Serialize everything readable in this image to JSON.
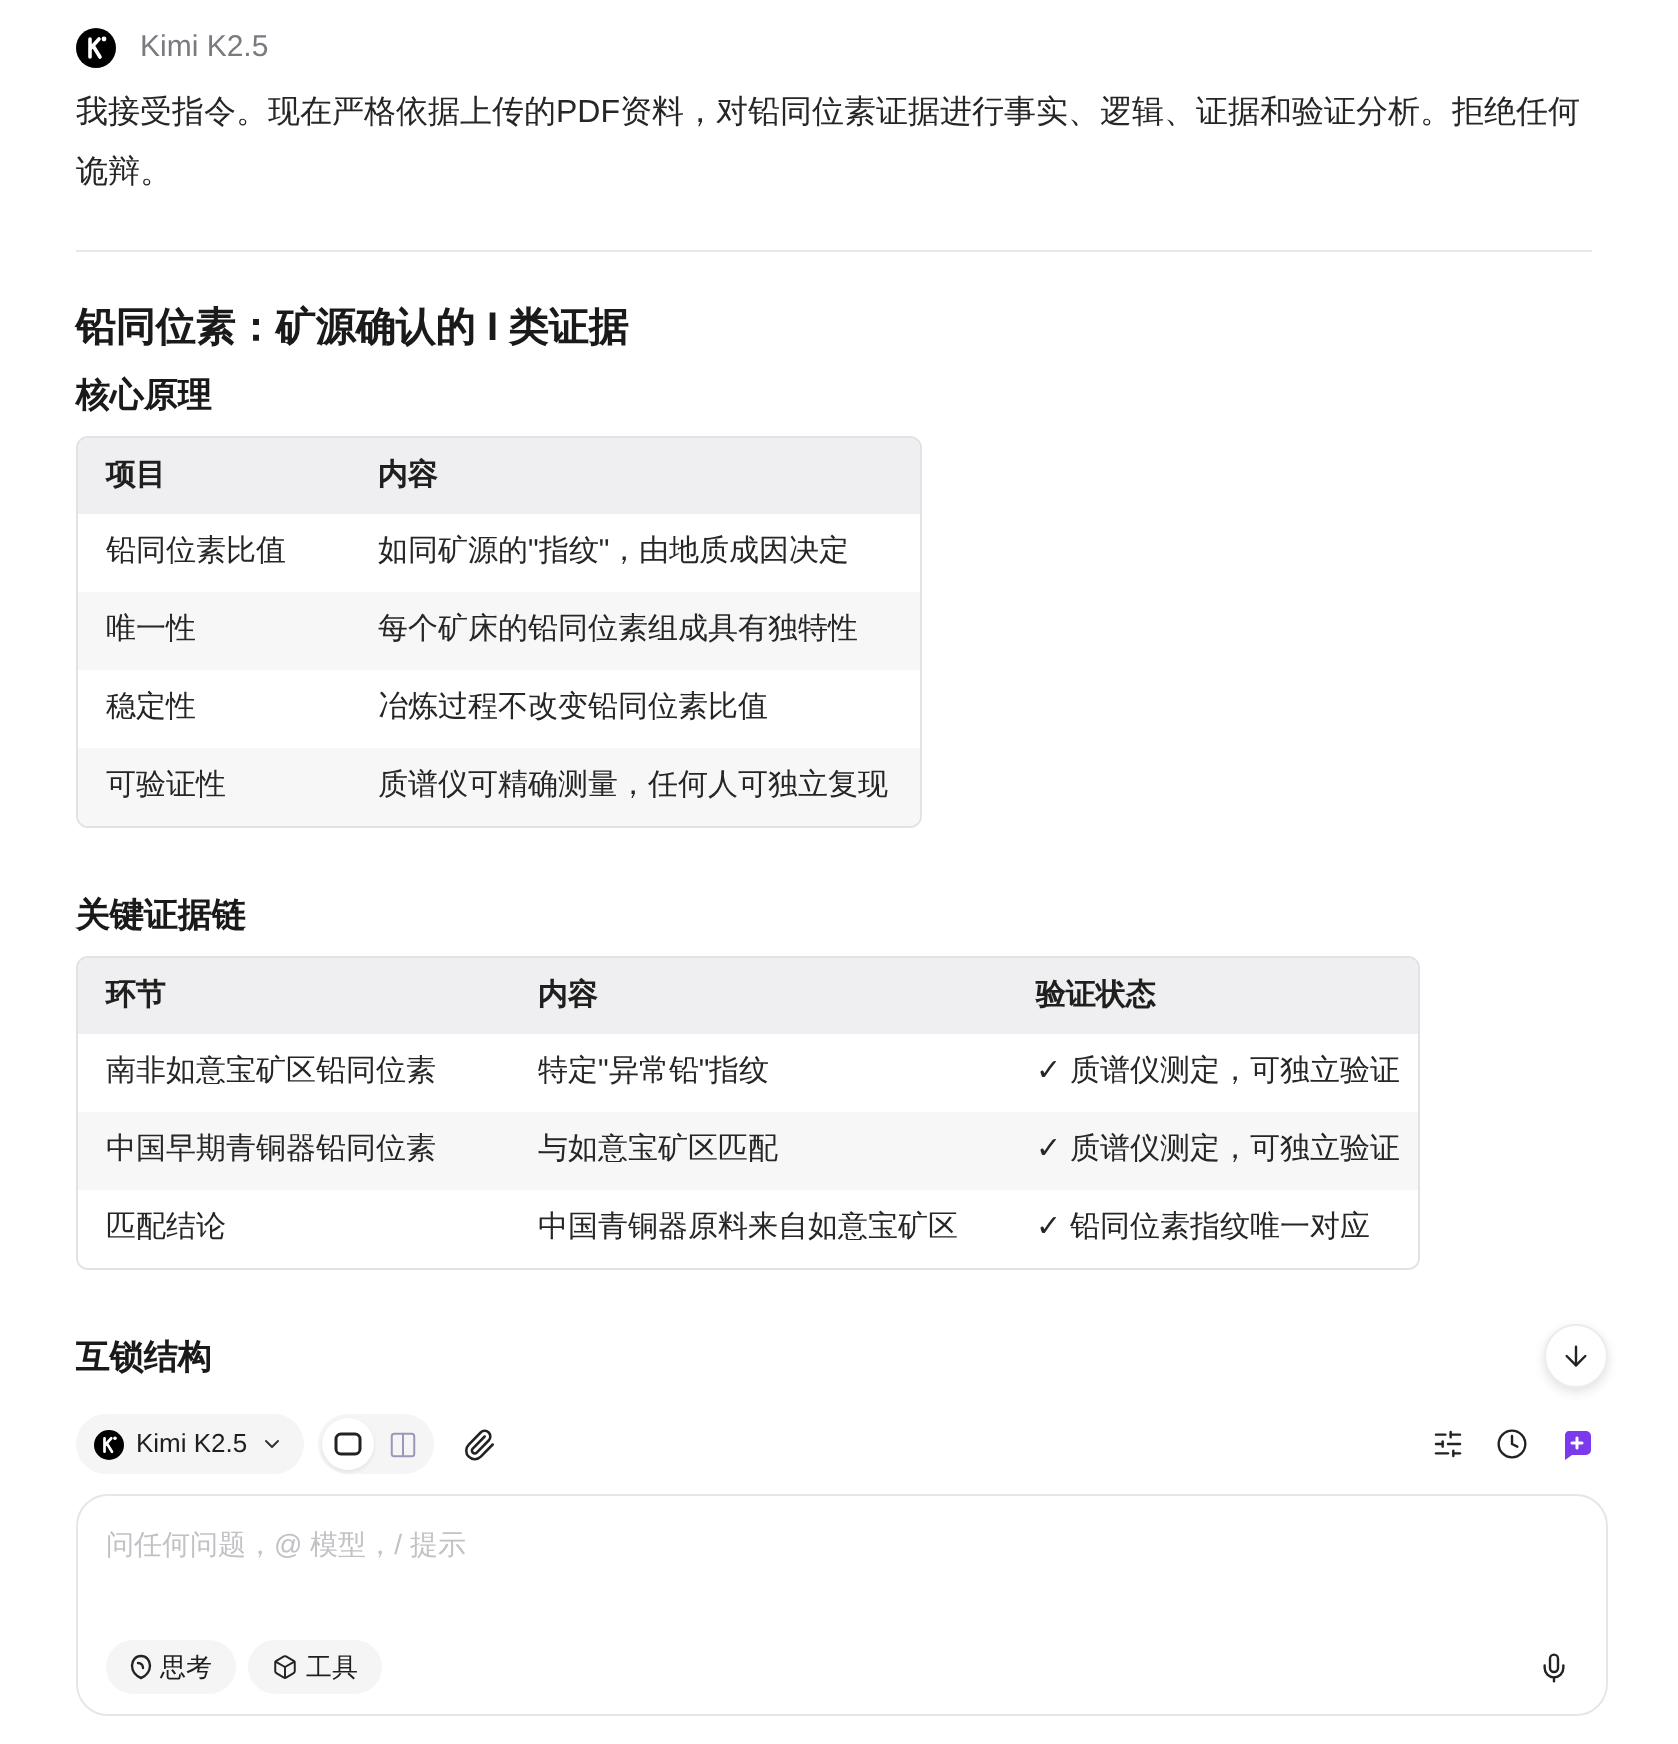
{
  "header": {
    "model": "Kimi K2.5"
  },
  "message": {
    "intro": "我接受指令。现在严格依据上传的PDF资料，对铅同位素证据进行事实、逻辑、证据和验证分析。拒绝任何诡辩。",
    "title": "铅同位素：矿源确认的 I 类证据",
    "sections": [
      {
        "heading": "核心原理",
        "table": {
          "columns": [
            "项目",
            "内容"
          ],
          "rows": [
            [
              "铅同位素比值",
              "如同矿源的\"指纹\"，由地质成因决定"
            ],
            [
              "唯一性",
              "每个矿床的铅同位素组成具有独特性"
            ],
            [
              "稳定性",
              "冶炼过程不改变铅同位素比值"
            ],
            [
              "可验证性",
              "质谱仪可精确测量，任何人可独立复现"
            ]
          ]
        }
      },
      {
        "heading": "关键证据链",
        "table": {
          "columns": [
            "环节",
            "内容",
            "验证状态"
          ],
          "rows": [
            [
              "南非如意宝矿区铅同位素",
              "特定\"异常铅\"指纹",
              "✓ 质谱仪测定，可独立验证"
            ],
            [
              "中国早期青铜器铅同位素",
              "与如意宝矿区匹配",
              "✓ 质谱仪测定，可独立验证"
            ],
            [
              "匹配结论",
              "中国青铜器原料来自如意宝矿区",
              "✓ 铅同位素指纹唯一对应"
            ]
          ]
        }
      },
      {
        "heading": "互锁结构"
      }
    ]
  },
  "composer": {
    "model": "Kimi K2.5",
    "layout_toggle": [
      {
        "kind": "single",
        "selected": true
      },
      {
        "kind": "split",
        "selected": false
      }
    ],
    "placeholder": "问任何问题，@ 模型，/ 提示",
    "chips": [
      {
        "kind": "think",
        "label": "思考"
      },
      {
        "kind": "tools",
        "label": "工具"
      }
    ]
  }
}
